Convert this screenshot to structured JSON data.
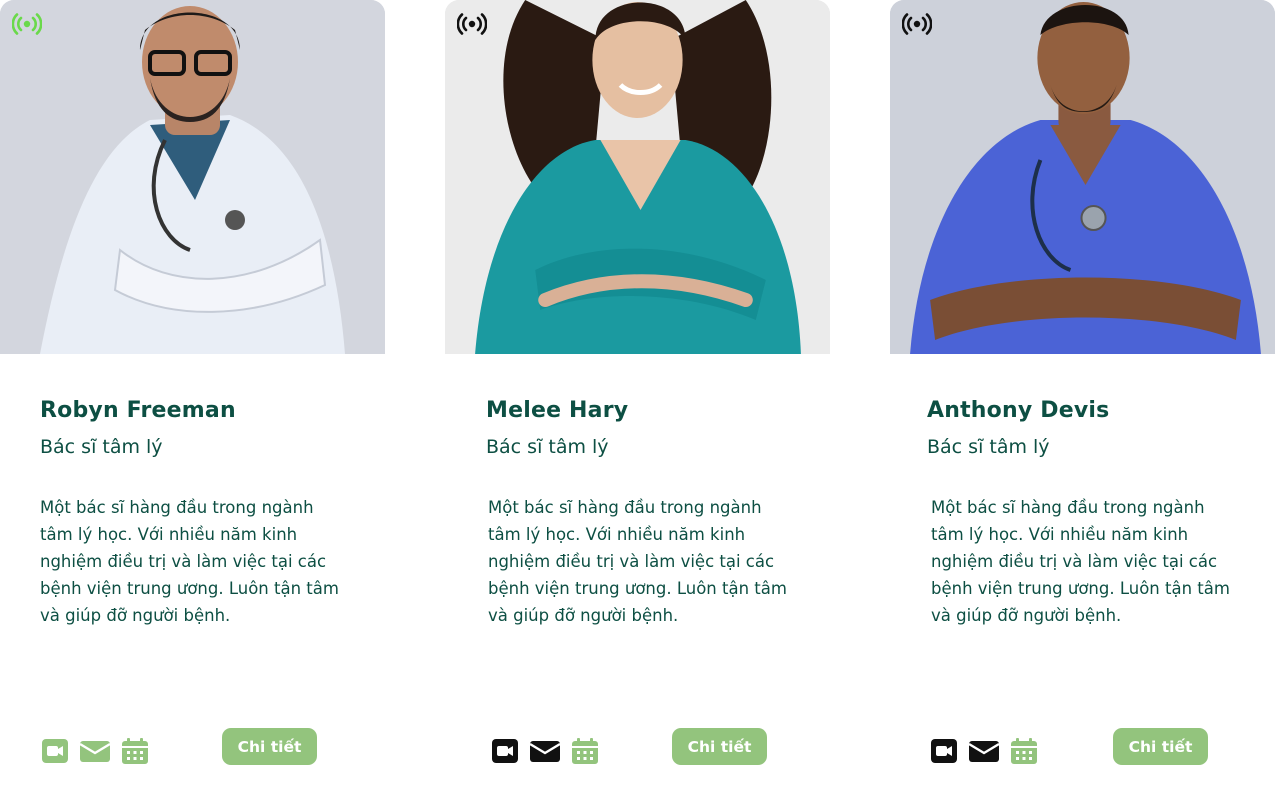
{
  "colors": {
    "accent_green": "#93c47d",
    "text_dark_green": "#0d4f43",
    "live_active": "#6ad94a",
    "icon_black": "#111111"
  },
  "doctors": [
    {
      "name": "Robyn Freeman",
      "role": "Bác sĩ tâm lý",
      "description": "Một bác sĩ hàng đầu trong ngành tâm lý học. Với nhiều năm kinh nghiệm điều trị và làm việc tại các bệnh viện trung ương. Luôn tận tâm và giúp đỡ người bệnh.",
      "detail_label": "Chi tiết",
      "live_icon": "broadcast-icon",
      "live_state": "active",
      "icons": [
        "video-camera-icon",
        "mail-icon",
        "calendar-icon"
      ],
      "icon_states": [
        "green",
        "green",
        "green"
      ]
    },
    {
      "name": "Melee Hary",
      "role": "Bác sĩ tâm lý",
      "description": "Một bác sĩ hàng đầu trong ngành tâm lý học. Với nhiều năm kinh nghiệm điều trị và làm việc tại các bệnh viện trung ương. Luôn tận tâm và giúp đỡ người bệnh.",
      "detail_label": "Chi tiết",
      "live_icon": "broadcast-icon",
      "live_state": "inactive",
      "icons": [
        "video-camera-icon",
        "mail-icon",
        "calendar-icon"
      ],
      "icon_states": [
        "black",
        "black",
        "green"
      ]
    },
    {
      "name": "Anthony Devis",
      "role": "Bác sĩ tâm lý",
      "description": "Một bác sĩ hàng đầu trong ngành tâm lý học. Với nhiều năm kinh nghiệm điều trị và làm việc tại các bệnh viện trung ương. Luôn tận tâm và giúp đỡ người bệnh.",
      "detail_label": "Chi tiết",
      "live_icon": "broadcast-icon",
      "live_state": "inactive",
      "icons": [
        "video-camera-icon",
        "mail-icon",
        "calendar-icon"
      ],
      "icon_states": [
        "black",
        "black",
        "green"
      ]
    }
  ]
}
